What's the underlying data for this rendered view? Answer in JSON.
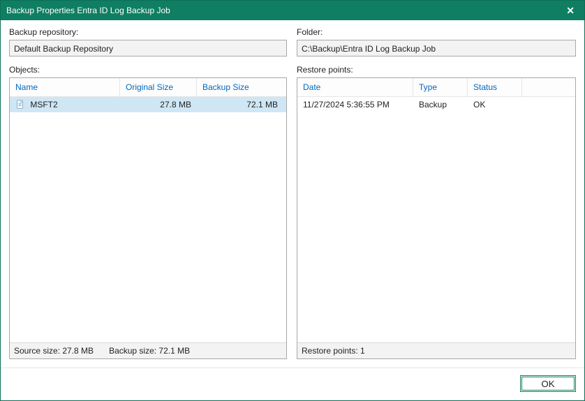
{
  "window": {
    "title": "Backup Properties Entra ID Log Backup Job"
  },
  "fields": {
    "repo_label": "Backup repository:",
    "repo_value": "Default Backup Repository",
    "folder_label": "Folder:",
    "folder_value": "C:\\Backup\\Entra ID Log Backup Job"
  },
  "objects": {
    "label": "Objects:",
    "headers": {
      "name": "Name",
      "original": "Original Size",
      "backup": "Backup Size"
    },
    "rows": [
      {
        "name": "MSFT2",
        "original": "27.8 MB",
        "backup": "72.1 MB"
      }
    ],
    "status": {
      "source": "Source size: 27.8 MB",
      "backup": "Backup size: 72.1 MB"
    }
  },
  "restore": {
    "label": "Restore points:",
    "headers": {
      "date": "Date",
      "type": "Type",
      "status": "Status"
    },
    "rows": [
      {
        "date": "11/27/2024 5:36:55 PM",
        "type": "Backup",
        "status": "OK"
      }
    ],
    "summary": "Restore points: 1"
  },
  "buttons": {
    "ok": "OK"
  }
}
